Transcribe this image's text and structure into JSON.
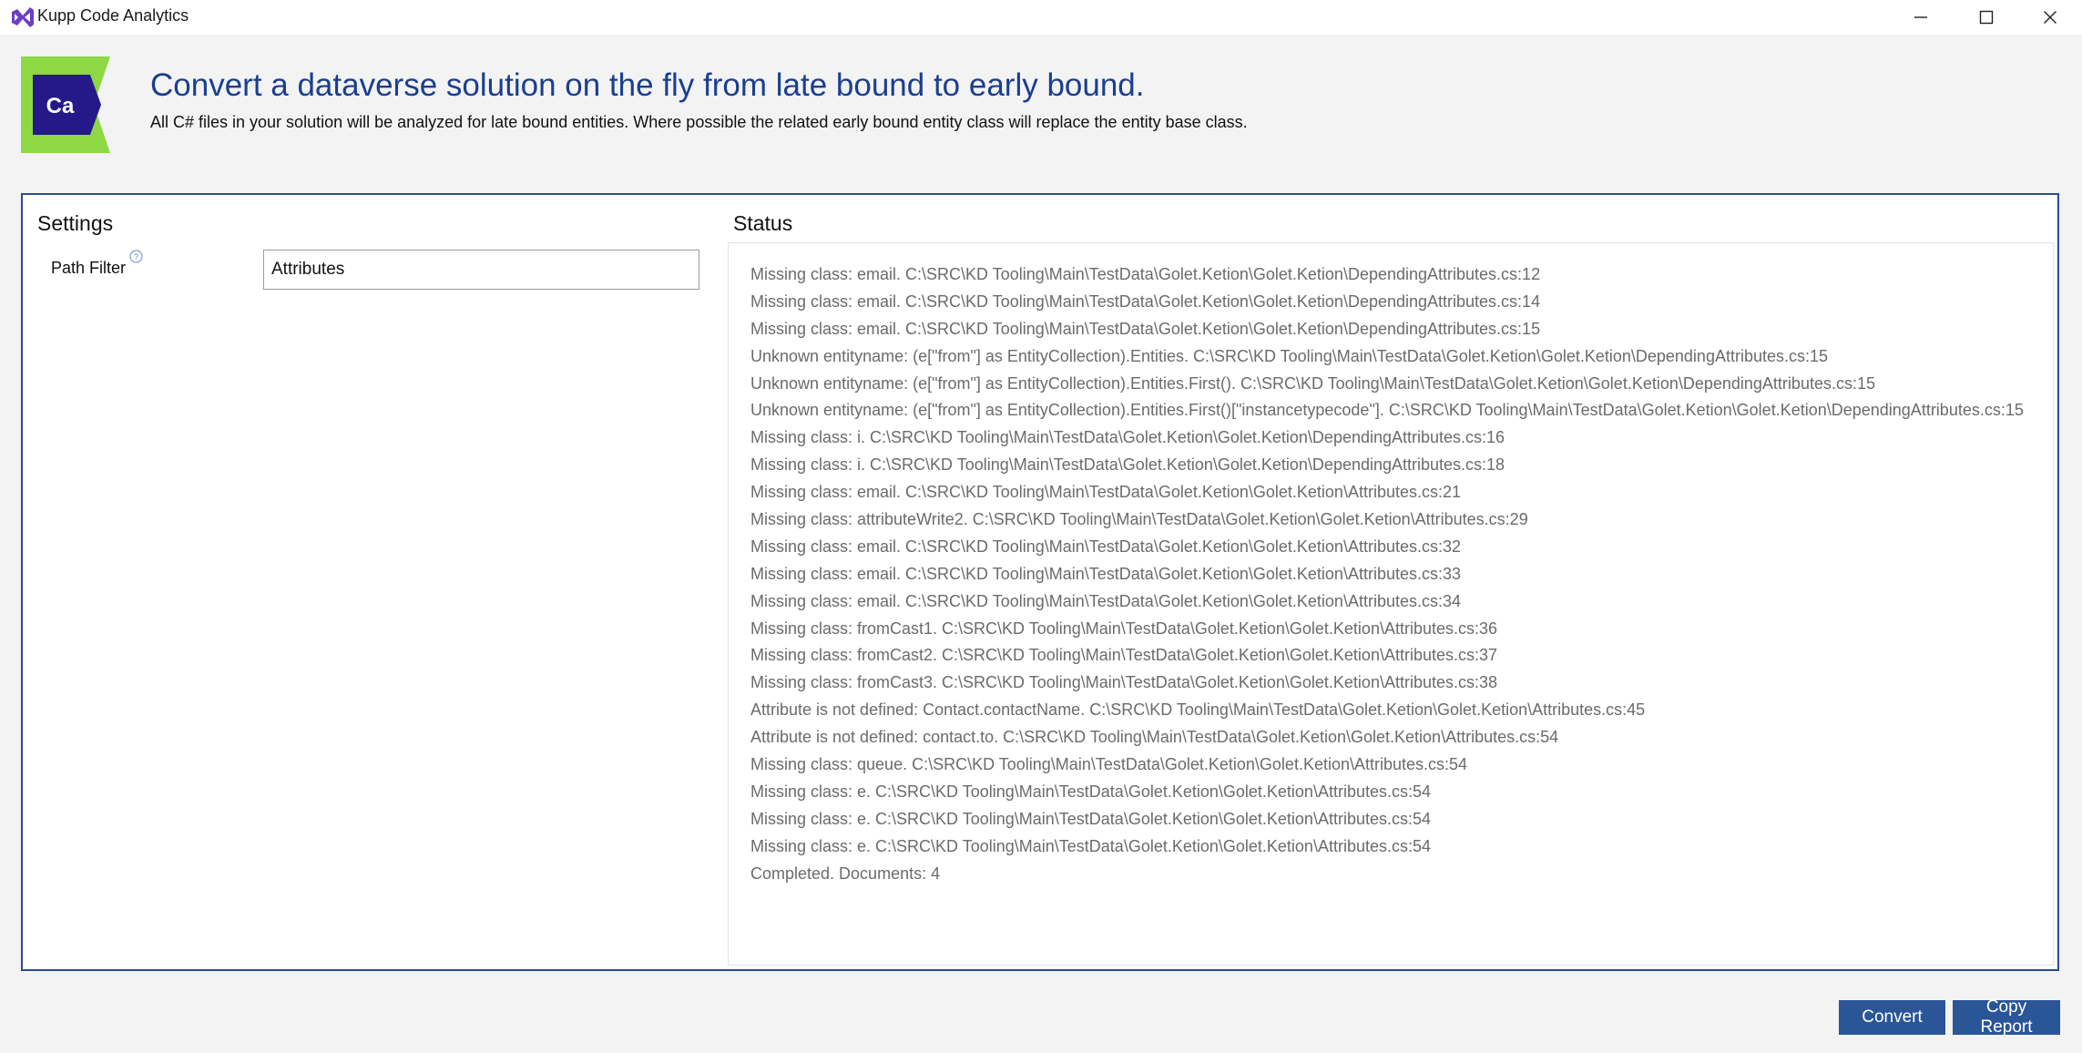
{
  "window": {
    "title": "Kupp Code Analytics",
    "icons": [
      "app-icon",
      "minimize-icon",
      "maximize-icon",
      "close-icon"
    ]
  },
  "header": {
    "logo_text": "Ca",
    "headline": "Convert a dataverse solution on the fly from late bound to early bound.",
    "description": "All C# files in your solution will be analyzed for late bound entities. Where possible the related early bound entity class will replace the entity base class."
  },
  "settings": {
    "title": "Settings",
    "path_filter_label": "Path Filter",
    "path_filter_value": "Attributes",
    "help_icon": "help-icon"
  },
  "status": {
    "title": "Status",
    "lines": [
      "Missing class: email. C:\\SRC\\KD Tooling\\Main\\TestData\\Golet.Ketion\\Golet.Ketion\\DependingAttributes.cs:12",
      "Missing class: email. C:\\SRC\\KD Tooling\\Main\\TestData\\Golet.Ketion\\Golet.Ketion\\DependingAttributes.cs:14",
      "Missing class: email. C:\\SRC\\KD Tooling\\Main\\TestData\\Golet.Ketion\\Golet.Ketion\\DependingAttributes.cs:15",
      "Unknown entityname: (e[\"from\"] as EntityCollection).Entities. C:\\SRC\\KD Tooling\\Main\\TestData\\Golet.Ketion\\Golet.Ketion\\DependingAttributes.cs:15",
      "Unknown entityname: (e[\"from\"] as EntityCollection).Entities.First(). C:\\SRC\\KD Tooling\\Main\\TestData\\Golet.Ketion\\Golet.Ketion\\DependingAttributes.cs:15",
      "Unknown entityname: (e[\"from\"] as EntityCollection).Entities.First()[\"instancetypecode\"]. C:\\SRC\\KD Tooling\\Main\\TestData\\Golet.Ketion\\Golet.Ketion\\DependingAttributes.cs:15",
      "Missing class: i. C:\\SRC\\KD Tooling\\Main\\TestData\\Golet.Ketion\\Golet.Ketion\\DependingAttributes.cs:16",
      "Missing class: i. C:\\SRC\\KD Tooling\\Main\\TestData\\Golet.Ketion\\Golet.Ketion\\DependingAttributes.cs:18",
      "Missing class: email. C:\\SRC\\KD Tooling\\Main\\TestData\\Golet.Ketion\\Golet.Ketion\\Attributes.cs:21",
      "Missing class: attributeWrite2. C:\\SRC\\KD Tooling\\Main\\TestData\\Golet.Ketion\\Golet.Ketion\\Attributes.cs:29",
      "Missing class: email. C:\\SRC\\KD Tooling\\Main\\TestData\\Golet.Ketion\\Golet.Ketion\\Attributes.cs:32",
      "Missing class: email. C:\\SRC\\KD Tooling\\Main\\TestData\\Golet.Ketion\\Golet.Ketion\\Attributes.cs:33",
      "Missing class: email. C:\\SRC\\KD Tooling\\Main\\TestData\\Golet.Ketion\\Golet.Ketion\\Attributes.cs:34",
      "Missing class: fromCast1. C:\\SRC\\KD Tooling\\Main\\TestData\\Golet.Ketion\\Golet.Ketion\\Attributes.cs:36",
      "Missing class: fromCast2. C:\\SRC\\KD Tooling\\Main\\TestData\\Golet.Ketion\\Golet.Ketion\\Attributes.cs:37",
      "Missing class: fromCast3. C:\\SRC\\KD Tooling\\Main\\TestData\\Golet.Ketion\\Golet.Ketion\\Attributes.cs:38",
      "Attribute is not defined: Contact.contactName. C:\\SRC\\KD Tooling\\Main\\TestData\\Golet.Ketion\\Golet.Ketion\\Attributes.cs:45",
      "Attribute is not defined: contact.to. C:\\SRC\\KD Tooling\\Main\\TestData\\Golet.Ketion\\Golet.Ketion\\Attributes.cs:54",
      "Missing class: queue. C:\\SRC\\KD Tooling\\Main\\TestData\\Golet.Ketion\\Golet.Ketion\\Attributes.cs:54",
      "Missing class: e. C:\\SRC\\KD Tooling\\Main\\TestData\\Golet.Ketion\\Golet.Ketion\\Attributes.cs:54",
      "Missing class: e. C:\\SRC\\KD Tooling\\Main\\TestData\\Golet.Ketion\\Golet.Ketion\\Attributes.cs:54",
      "Missing class: e. C:\\SRC\\KD Tooling\\Main\\TestData\\Golet.Ketion\\Golet.Ketion\\Attributes.cs:54",
      "Completed. Documents: 4"
    ]
  },
  "buttons": {
    "convert": "Convert",
    "copy_report": "Copy Report"
  },
  "colors": {
    "accent": "#2a5697",
    "headline": "#1a3f8f",
    "logo_green": "#8ed843",
    "logo_blue": "#25198a",
    "panel_border": "#2a4d8e",
    "status_text": "#6b6b6b"
  }
}
